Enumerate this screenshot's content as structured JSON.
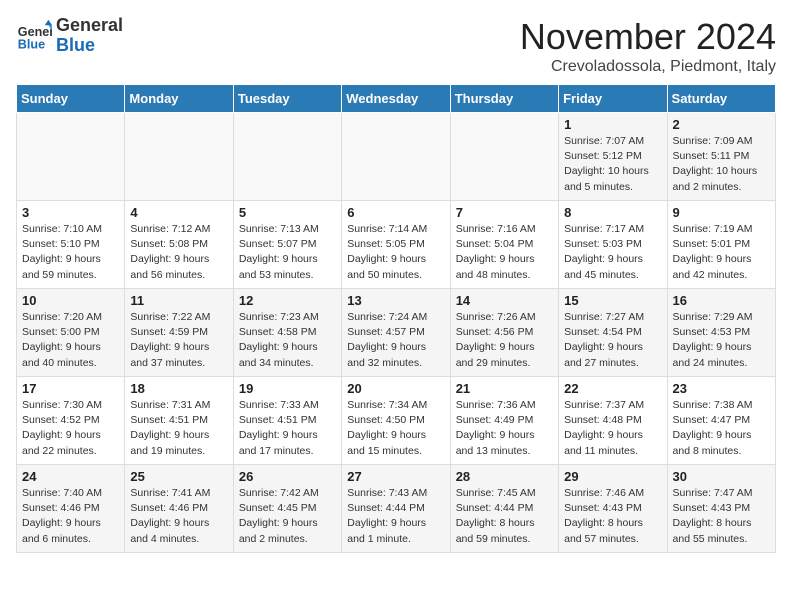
{
  "header": {
    "logo_general": "General",
    "logo_blue": "Blue",
    "month_title": "November 2024",
    "location": "Crevoladossola, Piedmont, Italy"
  },
  "days_of_week": [
    "Sunday",
    "Monday",
    "Tuesday",
    "Wednesday",
    "Thursday",
    "Friday",
    "Saturday"
  ],
  "weeks": [
    {
      "days": [
        {
          "number": "",
          "info": ""
        },
        {
          "number": "",
          "info": ""
        },
        {
          "number": "",
          "info": ""
        },
        {
          "number": "",
          "info": ""
        },
        {
          "number": "",
          "info": ""
        },
        {
          "number": "1",
          "info": "Sunrise: 7:07 AM\nSunset: 5:12 PM\nDaylight: 10 hours and 5 minutes."
        },
        {
          "number": "2",
          "info": "Sunrise: 7:09 AM\nSunset: 5:11 PM\nDaylight: 10 hours and 2 minutes."
        }
      ]
    },
    {
      "days": [
        {
          "number": "3",
          "info": "Sunrise: 7:10 AM\nSunset: 5:10 PM\nDaylight: 9 hours and 59 minutes."
        },
        {
          "number": "4",
          "info": "Sunrise: 7:12 AM\nSunset: 5:08 PM\nDaylight: 9 hours and 56 minutes."
        },
        {
          "number": "5",
          "info": "Sunrise: 7:13 AM\nSunset: 5:07 PM\nDaylight: 9 hours and 53 minutes."
        },
        {
          "number": "6",
          "info": "Sunrise: 7:14 AM\nSunset: 5:05 PM\nDaylight: 9 hours and 50 minutes."
        },
        {
          "number": "7",
          "info": "Sunrise: 7:16 AM\nSunset: 5:04 PM\nDaylight: 9 hours and 48 minutes."
        },
        {
          "number": "8",
          "info": "Sunrise: 7:17 AM\nSunset: 5:03 PM\nDaylight: 9 hours and 45 minutes."
        },
        {
          "number": "9",
          "info": "Sunrise: 7:19 AM\nSunset: 5:01 PM\nDaylight: 9 hours and 42 minutes."
        }
      ]
    },
    {
      "days": [
        {
          "number": "10",
          "info": "Sunrise: 7:20 AM\nSunset: 5:00 PM\nDaylight: 9 hours and 40 minutes."
        },
        {
          "number": "11",
          "info": "Sunrise: 7:22 AM\nSunset: 4:59 PM\nDaylight: 9 hours and 37 minutes."
        },
        {
          "number": "12",
          "info": "Sunrise: 7:23 AM\nSunset: 4:58 PM\nDaylight: 9 hours and 34 minutes."
        },
        {
          "number": "13",
          "info": "Sunrise: 7:24 AM\nSunset: 4:57 PM\nDaylight: 9 hours and 32 minutes."
        },
        {
          "number": "14",
          "info": "Sunrise: 7:26 AM\nSunset: 4:56 PM\nDaylight: 9 hours and 29 minutes."
        },
        {
          "number": "15",
          "info": "Sunrise: 7:27 AM\nSunset: 4:54 PM\nDaylight: 9 hours and 27 minutes."
        },
        {
          "number": "16",
          "info": "Sunrise: 7:29 AM\nSunset: 4:53 PM\nDaylight: 9 hours and 24 minutes."
        }
      ]
    },
    {
      "days": [
        {
          "number": "17",
          "info": "Sunrise: 7:30 AM\nSunset: 4:52 PM\nDaylight: 9 hours and 22 minutes."
        },
        {
          "number": "18",
          "info": "Sunrise: 7:31 AM\nSunset: 4:51 PM\nDaylight: 9 hours and 19 minutes."
        },
        {
          "number": "19",
          "info": "Sunrise: 7:33 AM\nSunset: 4:51 PM\nDaylight: 9 hours and 17 minutes."
        },
        {
          "number": "20",
          "info": "Sunrise: 7:34 AM\nSunset: 4:50 PM\nDaylight: 9 hours and 15 minutes."
        },
        {
          "number": "21",
          "info": "Sunrise: 7:36 AM\nSunset: 4:49 PM\nDaylight: 9 hours and 13 minutes."
        },
        {
          "number": "22",
          "info": "Sunrise: 7:37 AM\nSunset: 4:48 PM\nDaylight: 9 hours and 11 minutes."
        },
        {
          "number": "23",
          "info": "Sunrise: 7:38 AM\nSunset: 4:47 PM\nDaylight: 9 hours and 8 minutes."
        }
      ]
    },
    {
      "days": [
        {
          "number": "24",
          "info": "Sunrise: 7:40 AM\nSunset: 4:46 PM\nDaylight: 9 hours and 6 minutes."
        },
        {
          "number": "25",
          "info": "Sunrise: 7:41 AM\nSunset: 4:46 PM\nDaylight: 9 hours and 4 minutes."
        },
        {
          "number": "26",
          "info": "Sunrise: 7:42 AM\nSunset: 4:45 PM\nDaylight: 9 hours and 2 minutes."
        },
        {
          "number": "27",
          "info": "Sunrise: 7:43 AM\nSunset: 4:44 PM\nDaylight: 9 hours and 1 minute."
        },
        {
          "number": "28",
          "info": "Sunrise: 7:45 AM\nSunset: 4:44 PM\nDaylight: 8 hours and 59 minutes."
        },
        {
          "number": "29",
          "info": "Sunrise: 7:46 AM\nSunset: 4:43 PM\nDaylight: 8 hours and 57 minutes."
        },
        {
          "number": "30",
          "info": "Sunrise: 7:47 AM\nSunset: 4:43 PM\nDaylight: 8 hours and 55 minutes."
        }
      ]
    }
  ]
}
